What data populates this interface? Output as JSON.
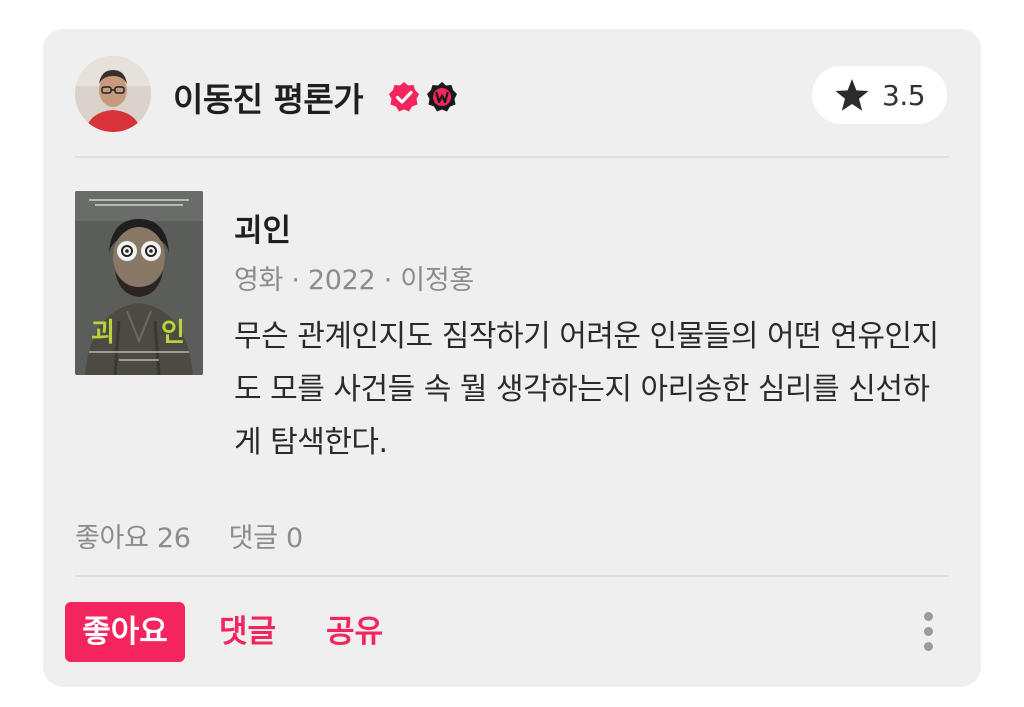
{
  "review_card": {
    "reviewer": {
      "name": "이동진 평론가",
      "icons": [
        "avatar-photo",
        "verified-check-icon",
        "watcha-w-badge-icon"
      ]
    },
    "rating": {
      "icon": "star-icon",
      "value": "3.5"
    },
    "content": {
      "title": "괴인",
      "meta": "영화 · 2022 · 이정홍",
      "review_text": "무슨 관계인지도 짐작하기 어려운 인물들의 어떤 연유인지도 모를 사건들 속 뭘 생각하는지 아리송한 심리를 신선하게 탐색한다.",
      "poster_title_text": "괴인"
    },
    "stats": {
      "likes": "좋아요 26",
      "comments": "댓글 0"
    },
    "actions": {
      "like_label": "좋아요",
      "comment_label": "댓글",
      "share_label": "공유",
      "more_icon": "vertical-dots-icon"
    },
    "colors": {
      "accent": "#f4245e",
      "card_background": "#efefef",
      "muted_text": "#8c8c8c"
    }
  }
}
